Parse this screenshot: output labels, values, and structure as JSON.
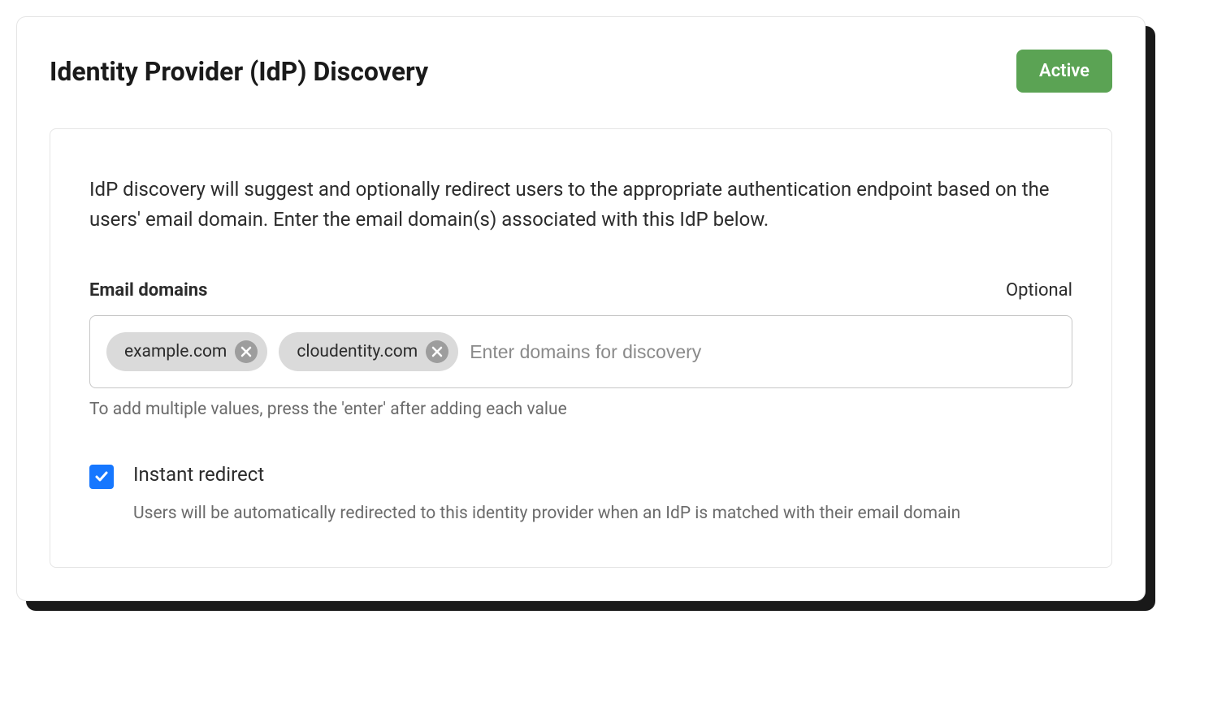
{
  "header": {
    "title": "Identity Provider (IdP) Discovery",
    "status_label": "Active"
  },
  "content": {
    "description": "IdP discovery will suggest and optionally redirect users to the appropriate authentication endpoint based on the users' email domain. Enter the email domain(s) associated with this IdP below.",
    "email_domains": {
      "label": "Email domains",
      "optional_label": "Optional",
      "chips": [
        {
          "text": "example.com"
        },
        {
          "text": "cloudentity.com"
        }
      ],
      "input_placeholder": "Enter domains for discovery",
      "helper_text": "To add multiple values, press the 'enter' after adding each value"
    },
    "instant_redirect": {
      "checked": true,
      "label": "Instant redirect",
      "description": "Users will be automatically redirected to this identity provider when an IdP is matched with their email domain"
    }
  },
  "colors": {
    "accent_green": "#5ba354",
    "accent_blue": "#1677ff",
    "chip_bg": "#dadada",
    "chip_close": "#9d9d9d"
  }
}
